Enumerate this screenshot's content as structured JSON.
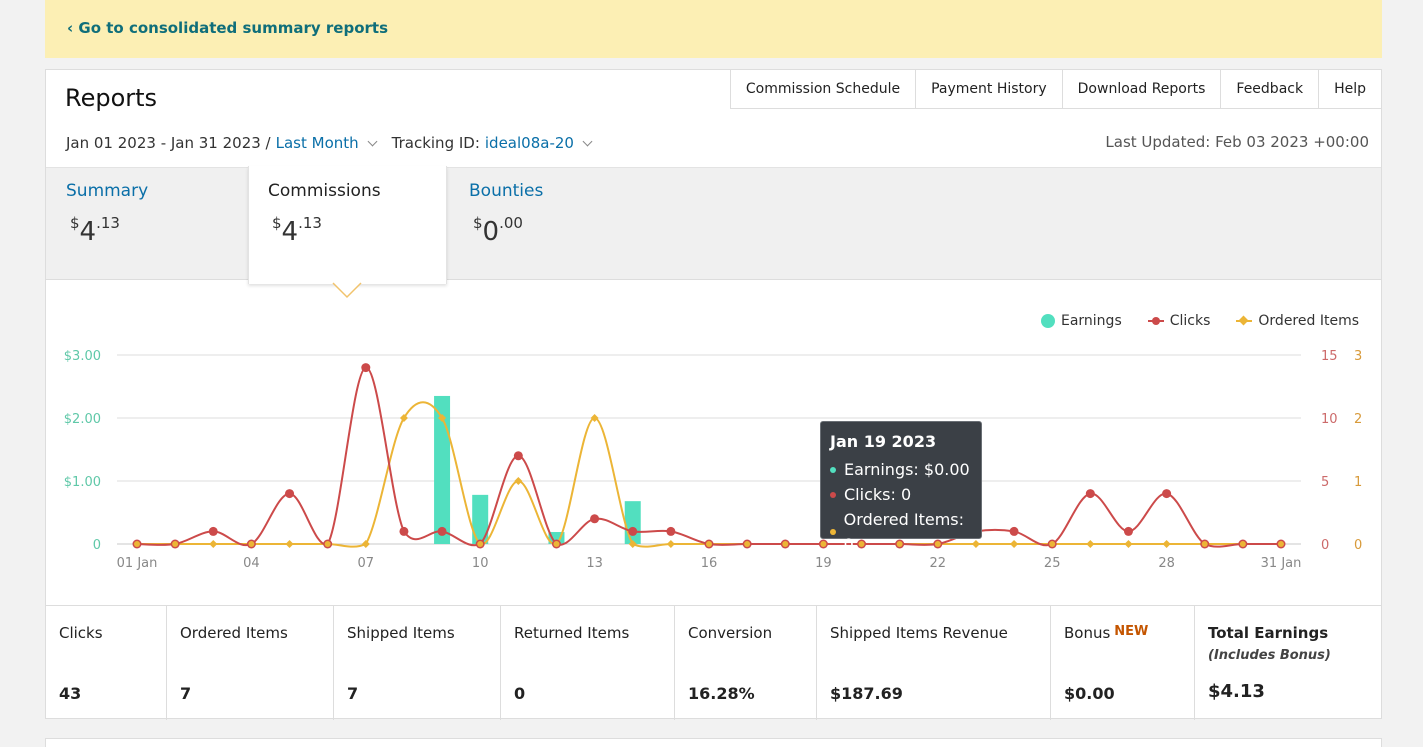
{
  "banner": {
    "link": "‹ Go to consolidated summary reports"
  },
  "header": {
    "title": "Reports",
    "nav": [
      "Commission Schedule",
      "Payment History",
      "Download Reports",
      "Feedback",
      "Help"
    ],
    "date_range": "Jan 01 2023 - Jan 31 2023 /",
    "period": "Last Month",
    "tracking_label": "Tracking ID:",
    "tracking_id": "ideal08a-20",
    "last_updated": "Last Updated: Feb 03 2023 +00:00"
  },
  "tabs": [
    {
      "label": "Summary",
      "currency": "$",
      "whole": "4",
      "cents": ".13"
    },
    {
      "label": "Commissions",
      "currency": "$",
      "whole": "4",
      "cents": ".13"
    },
    {
      "label": "Bounties",
      "currency": "$",
      "whole": "0",
      "cents": ".00"
    }
  ],
  "legend": [
    "Earnings",
    "Clicks",
    "Ordered Items"
  ],
  "colors": {
    "earnings": "#52dfbf",
    "clicks": "#cc4a4a",
    "ordered": "#ecb536",
    "link": "#0a6fa8"
  },
  "tooltip": {
    "date": "Jan 19 2023",
    "earnings": "Earnings: $0.00",
    "clicks": "Clicks: 0",
    "ordered": "Ordered Items: 0"
  },
  "chart_data": {
    "type": "bar",
    "x": [
      1,
      2,
      3,
      4,
      5,
      6,
      7,
      8,
      9,
      10,
      11,
      12,
      13,
      14,
      15,
      16,
      17,
      18,
      19,
      20,
      21,
      22,
      23,
      24,
      25,
      26,
      27,
      28,
      29,
      30,
      31
    ],
    "x_tick_labels": [
      "01 Jan",
      "04",
      "07",
      "10",
      "13",
      "16",
      "19",
      "22",
      "25",
      "28",
      "31 Jan"
    ],
    "x_tick_positions": [
      1,
      4,
      7,
      10,
      13,
      16,
      19,
      22,
      25,
      28,
      31
    ],
    "series": [
      {
        "name": "Earnings",
        "type": "bar",
        "axis": "left",
        "values": [
          0,
          0,
          0,
          0,
          0,
          0,
          0,
          0,
          2.35,
          0.78,
          0,
          0.19,
          0,
          0.68,
          0,
          0,
          0,
          0,
          0,
          0,
          0,
          0,
          0,
          0,
          0,
          0,
          0,
          0,
          0,
          0,
          0
        ]
      },
      {
        "name": "Clicks",
        "type": "line",
        "axis": "right-1",
        "values": [
          0,
          0,
          1,
          0,
          4,
          0,
          14,
          1,
          1,
          0,
          7,
          0,
          2,
          1,
          1,
          0,
          0,
          0,
          0,
          0,
          0,
          0,
          1,
          1,
          0,
          4,
          1,
          4,
          0,
          0,
          0
        ]
      },
      {
        "name": "Ordered Items",
        "type": "line",
        "axis": "right-2",
        "values": [
          0,
          0,
          0,
          0,
          0,
          0,
          0,
          2,
          2,
          0,
          1,
          0,
          2,
          0,
          0,
          0,
          0,
          0,
          0,
          0,
          0,
          0,
          0,
          0,
          0,
          0,
          0,
          0,
          0,
          0,
          0
        ]
      }
    ],
    "y_left": {
      "ticks": [
        "$3.00",
        "$2.00",
        "$1.00",
        "0"
      ],
      "range": [
        0,
        3
      ]
    },
    "y_right_1": {
      "ticks": [
        "15",
        "10",
        "5",
        "0"
      ],
      "range": [
        0,
        15
      ]
    },
    "y_right_2": {
      "ticks": [
        "3",
        "2",
        "1",
        "0"
      ],
      "range": [
        0,
        3
      ]
    },
    "grid": true,
    "legend_position": "top-right"
  },
  "stats": [
    {
      "label": "Clicks",
      "value": "43"
    },
    {
      "label": "Ordered Items",
      "value": "7"
    },
    {
      "label": "Shipped Items",
      "value": "7"
    },
    {
      "label": "Returned Items",
      "value": "0"
    },
    {
      "label": "Conversion",
      "value": "16.28%"
    },
    {
      "label": "Shipped Items Revenue",
      "value": "$187.69"
    },
    {
      "label": "Bonus",
      "badge": "NEW",
      "value": "$0.00"
    },
    {
      "label": "Total Earnings",
      "sub": "(Includes Bonus)",
      "value": "$4.13"
    }
  ]
}
